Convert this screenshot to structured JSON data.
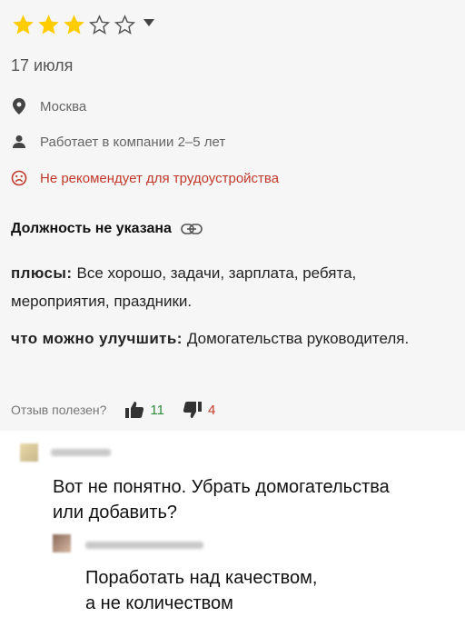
{
  "review": {
    "rating": 3,
    "rating_max": 5,
    "date": "17 июля",
    "location": "Москва",
    "tenure": "Работает в компании 2–5 лет",
    "recommendation": "Не рекомендует для трудоустройства",
    "position": "Должность не указана",
    "pros_label": "плюсы",
    "pros_text": "Все хорошо, задачи, зарплата, ребята, мероприятия, праздники.",
    "improve_label": "что можно улучшить",
    "improve_text": "Домогательства руководителя.",
    "helpful_question": "Отзыв полезен?",
    "helpful_yes": "11",
    "helpful_no": "4"
  },
  "comments": [
    {
      "text_line1": "Вот не понятно. Убрать домогательства",
      "text_line2": "или добавить?"
    },
    {
      "text_line1": "Поработать над качеством,",
      "text_line2": "а не количеством"
    }
  ],
  "colors": {
    "star": "#ffcc00",
    "star_outline": "#555555",
    "positive": "#2e8b3a",
    "negative": "#c0392b"
  }
}
